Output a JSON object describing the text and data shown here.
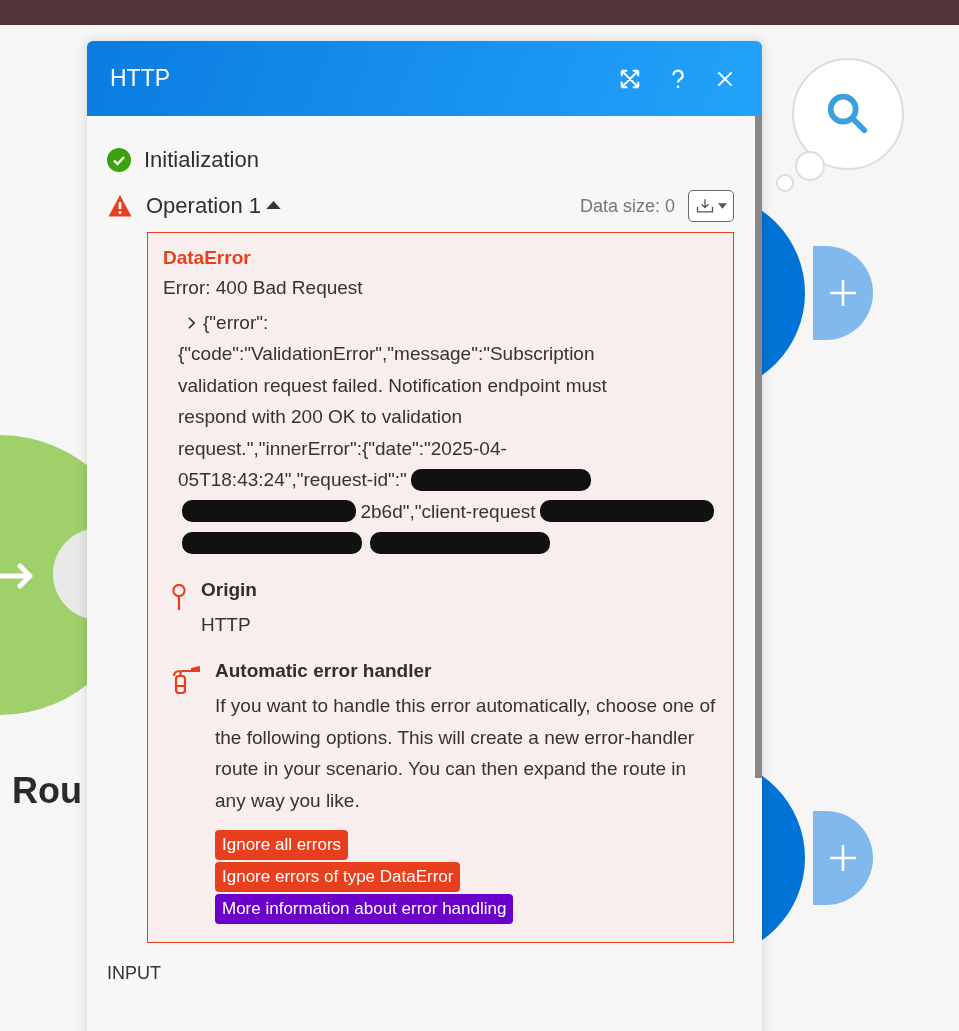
{
  "canvas": {
    "node_label": "Rou"
  },
  "dialog": {
    "title": "HTTP",
    "steps": [
      {
        "label": "Initialization",
        "kind": "success"
      },
      {
        "label": "Operation 1",
        "kind": "error",
        "expanded": true
      }
    ],
    "data_size": "Data size: 0",
    "error": {
      "type": "DataError",
      "summary": "Error: 400 Bad Request",
      "detail_first": "{\"error\":",
      "detail_lines": [
        [
          {
            "kind": "text",
            "text": "{\"code\":\"ValidationError\",\"message\":\"Subscription"
          }
        ],
        [
          {
            "kind": "text",
            "text": "validation request failed. Notification endpoint must"
          }
        ],
        [
          {
            "kind": "text",
            "text": "respond with 200 OK to validation"
          }
        ],
        [
          {
            "kind": "text",
            "text": "request.\",\"innerError\":{\"date\":\"2025-04-"
          }
        ],
        [
          {
            "kind": "text",
            "text": "05T18:43:24\",\"request-id\":\""
          },
          {
            "kind": "redacted"
          }
        ],
        [
          {
            "kind": "redacted"
          },
          {
            "kind": "text",
            "text": "2b6d\",\"client-request"
          },
          {
            "kind": "redacted"
          }
        ],
        [
          {
            "kind": "redacted"
          },
          {
            "kind": "redacted"
          }
        ]
      ],
      "origin_label": "Origin",
      "origin_value": "HTTP",
      "handler_title": "Automatic error handler",
      "handler_text": "If you want to handle this error automatically, choose one of the following options. This will create a new error-handler route in your scenario. You can then expand the route in any way you like.",
      "actions": [
        {
          "label": "Ignore all errors",
          "kind": "danger"
        },
        {
          "label": "Ignore errors of type DataError",
          "kind": "danger"
        },
        {
          "label": "More information about error handling",
          "kind": "info"
        }
      ]
    },
    "input_label": "INPUT"
  }
}
